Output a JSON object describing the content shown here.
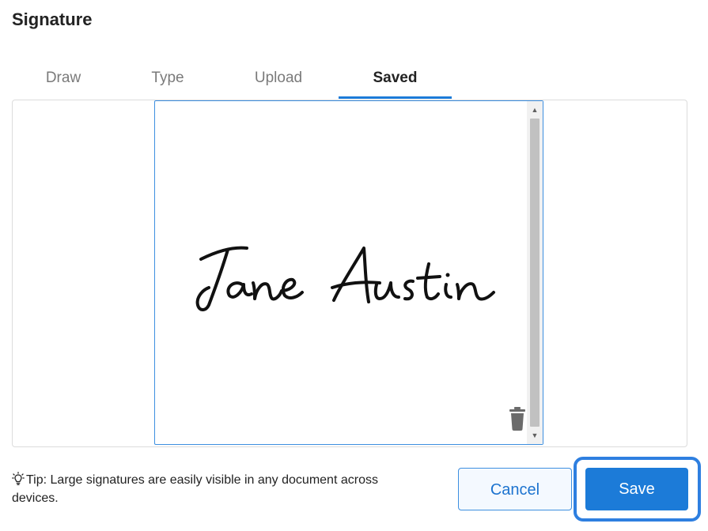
{
  "dialog": {
    "title": "Signature"
  },
  "tabs": [
    {
      "label": "Draw",
      "active": false
    },
    {
      "label": "Type",
      "active": false
    },
    {
      "label": "Upload",
      "active": false
    },
    {
      "label": "Saved",
      "active": true
    }
  ],
  "saved_signature": {
    "text": "Jane Austin",
    "delete_icon": "trash-icon"
  },
  "tip": {
    "icon": "lightbulb-icon",
    "text": "Tip: Large signatures are easily visible in any document across devices."
  },
  "buttons": {
    "cancel_label": "Cancel",
    "save_label": "Save"
  },
  "colors": {
    "accent": "#1c7bd8",
    "focus_ring": "#2e7fe0"
  }
}
